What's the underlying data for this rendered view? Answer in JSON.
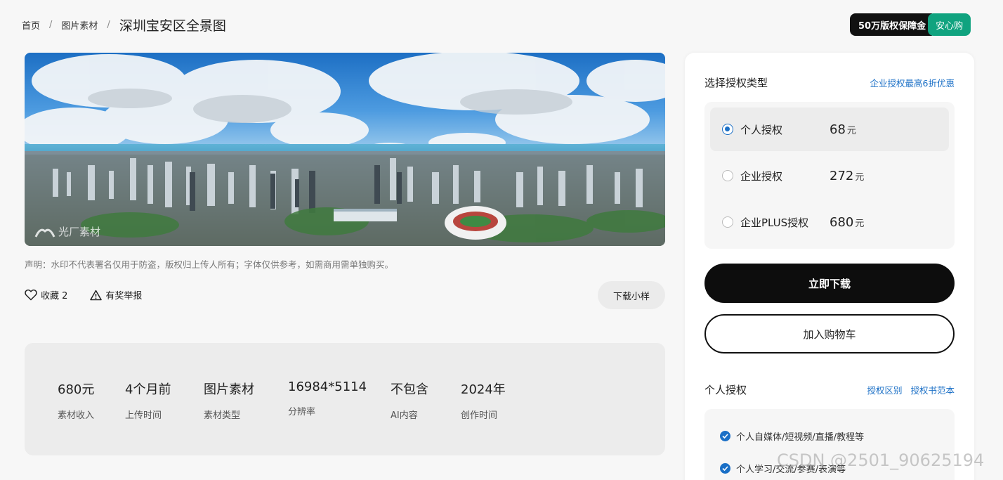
{
  "breadcrumb": {
    "home": "首页",
    "category": "图片素材",
    "separator": "/",
    "title": "深圳宝安区全景图"
  },
  "guarantee": {
    "left": "50万版权保障金",
    "right": "安心购"
  },
  "image": {
    "watermark": "光厂素材",
    "disclaimer": "声明：水印不代表署名仅用于防盗，版权归上传人所有；字体仅供参考，如需商用需单独购买。"
  },
  "actions": {
    "favorite_label": "收藏 2",
    "report_label": "有奖举报",
    "sample_label": "下载小样"
  },
  "info": [
    {
      "value": "680元",
      "label": "素材收入"
    },
    {
      "value": "4个月前",
      "label": "上传时间"
    },
    {
      "value": "图片素材",
      "label": "素材类型"
    },
    {
      "value": "16984*5114",
      "label": "分辨率"
    },
    {
      "value": "不包含",
      "label": "AI内容"
    },
    {
      "value": "2024年",
      "label": "创作时间"
    }
  ],
  "panel": {
    "title": "选择授权类型",
    "promo_link": "企业授权最高6折优惠",
    "options": [
      {
        "name": "个人授权",
        "price": "68",
        "unit": "元",
        "selected": true
      },
      {
        "name": "企业授权",
        "price": "272",
        "unit": "元",
        "selected": false
      },
      {
        "name": "企业PLUS授权",
        "price": "680",
        "unit": "元",
        "selected": false
      }
    ],
    "download_label": "立即下载",
    "cart_label": "加入购物车",
    "license_title": "个人授权",
    "license_diff_link": "授权区别",
    "license_sample_link": "授权书范本",
    "license_items": [
      "个人自媒体/短视频/直播/教程等",
      "个人学习/交流/参赛/表演等"
    ]
  },
  "site_watermark": "CSDN @2501_90625194",
  "colors": {
    "accent_blue": "#1a6fc6",
    "guarantee_green": "#10a37f",
    "primary_black": "#0d0d0d"
  }
}
